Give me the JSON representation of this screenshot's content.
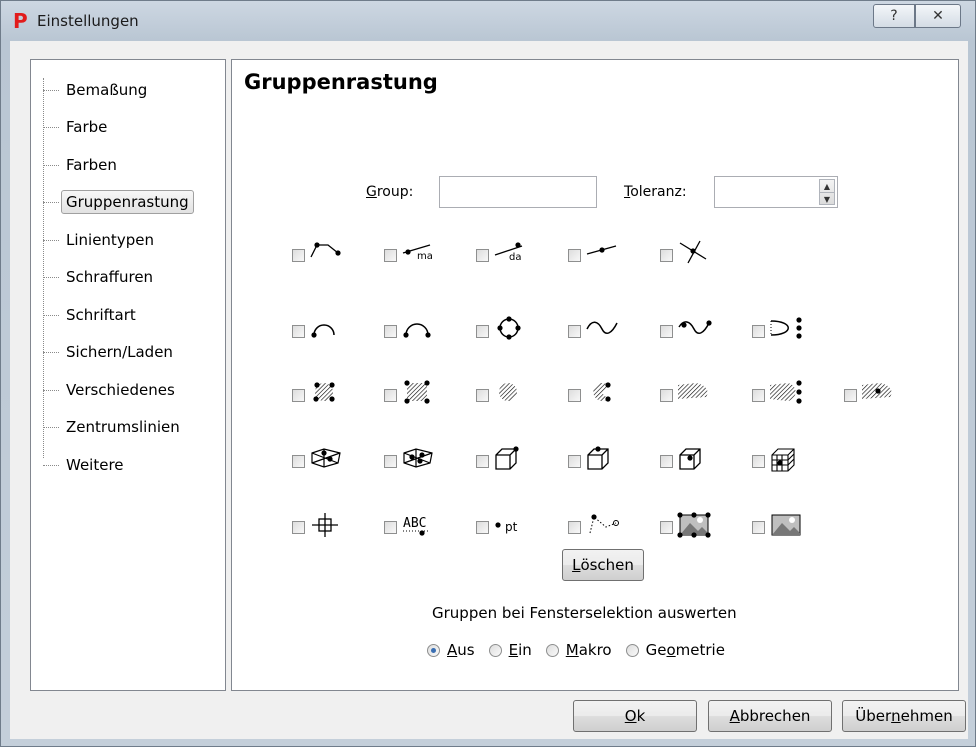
{
  "window": {
    "title": "Einstellungen",
    "app_icon_letter": "P",
    "help_glyph": "?",
    "close_glyph": "✕"
  },
  "tree": {
    "items": [
      {
        "label": "Bemaßung"
      },
      {
        "label": "Farbe"
      },
      {
        "label": "Farben"
      },
      {
        "label": "Gruppenrastung",
        "selected": true
      },
      {
        "label": "Linientypen"
      },
      {
        "label": "Schraffuren"
      },
      {
        "label": "Schriftart"
      },
      {
        "label": "Sichern/Laden"
      },
      {
        "label": "Verschiedenes"
      },
      {
        "label": "Zentrumslinien"
      },
      {
        "label": "Weitere"
      }
    ]
  },
  "panel": {
    "title": "Gruppenrastung",
    "group_label_mnemonic": "G",
    "group_label_rest": "roup:",
    "group_value": "",
    "tol_label_mnemonic": "T",
    "tol_label_rest": "oleranz:",
    "tol_value": "",
    "snap_rows": [
      [
        "line-endpoints",
        "line-ma",
        "line-da",
        "line-midpoint",
        "intersection"
      ],
      [
        "arc",
        "arc-endpoints",
        "circle-quadrants",
        "spline",
        "spline-points",
        "parabola-points"
      ],
      [
        "hatch-circle-points",
        "hatch-rect-points",
        "hatch-circle",
        "hatch-c-points",
        "hatch-blob",
        "hatch-blob-points",
        "hatch-blob-center"
      ],
      [
        "surface-points",
        "surface-grid",
        "cube-corner",
        "cube-point",
        "cube-center",
        "cube-grid"
      ],
      [
        "crosshair",
        "text-abc",
        "point-pt",
        "polyline-dotted",
        "image-corners",
        "image"
      ]
    ],
    "delete_mnemonic": "L",
    "delete_rest": "öschen",
    "group_eval_caption": "Gruppen bei Fensterselektion auswerten",
    "radio_options": [
      {
        "mnemonic": "A",
        "rest": "us",
        "checked": true
      },
      {
        "mnemonic": "E",
        "rest": "in",
        "checked": false
      },
      {
        "mnemonic": "M",
        "rest": "akro",
        "checked": false
      },
      {
        "pre": "Ge",
        "mnemonic": "o",
        "rest": "metrie",
        "checked": false
      }
    ]
  },
  "footer": {
    "ok_mnemonic": "O",
    "ok_rest": "k",
    "cancel_mnemonic": "A",
    "cancel_rest": "bbrechen",
    "apply_pre": "Über",
    "apply_mnemonic": "n",
    "apply_rest": "ehmen"
  }
}
